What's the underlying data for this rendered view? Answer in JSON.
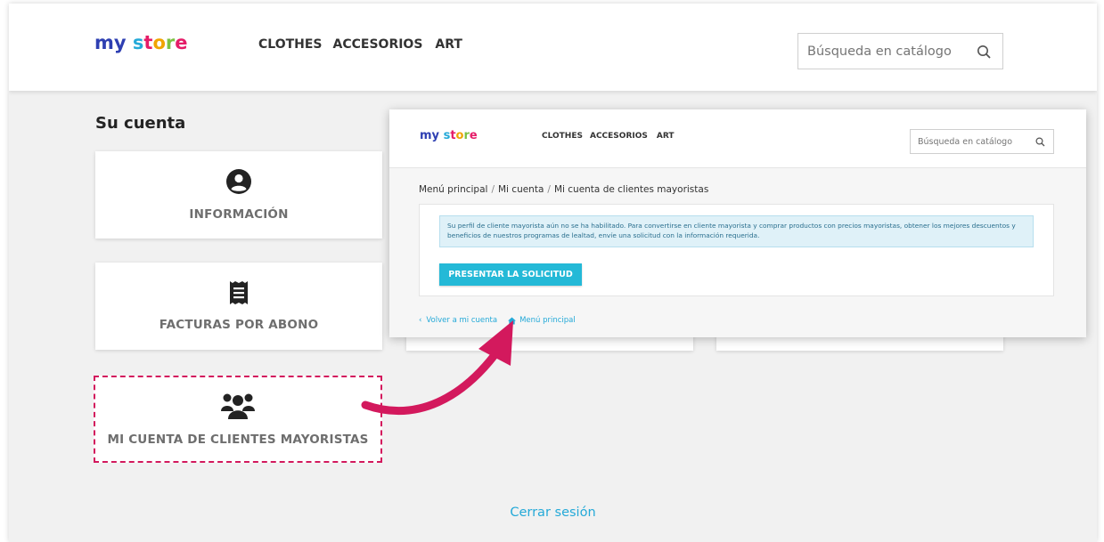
{
  "header": {
    "logo": [
      "my",
      " ",
      "s",
      "t",
      "o",
      "r",
      "e"
    ],
    "nav": [
      "CLOTHES",
      "ACCESORIOS",
      "ART"
    ],
    "search_placeholder": "Búsqueda en catálogo"
  },
  "page": {
    "title": "Su cuenta",
    "cards": [
      {
        "label": "INFORMACIÓN",
        "icon": "user-circle-icon"
      },
      {
        "label": "FACTURAS POR ABONO",
        "icon": "receipt-icon"
      },
      {
        "label": "MI CUENTA DE CLIENTES MAYORISTAS",
        "icon": "users-group-icon"
      }
    ],
    "logout": "Cerrar sesión"
  },
  "inset": {
    "nav": [
      "CLOTHES",
      "ACCESORIOS",
      "ART"
    ],
    "search_placeholder": "Búsqueda en catálogo",
    "breadcrumb": [
      "Menú principal",
      "Mi cuenta",
      "Mi cuenta de clientes mayoristas"
    ],
    "alert": "Su perfil de cliente mayorista aún no se ha habilitado. Para convertirse en cliente mayorista y comprar productos con precios mayoristas, obtener los mejores descuentos y beneficios de nuestros programas de lealtad, envíe una solicitud con la información requerida.",
    "button": "PRESENTAR LA SOLICITUD",
    "back_link": "Volver a mi cuenta",
    "home_link": "Menú principal"
  },
  "colors": {
    "accent": "#24a9d8",
    "button": "#24b9d7",
    "highlight": "#d3195d"
  }
}
